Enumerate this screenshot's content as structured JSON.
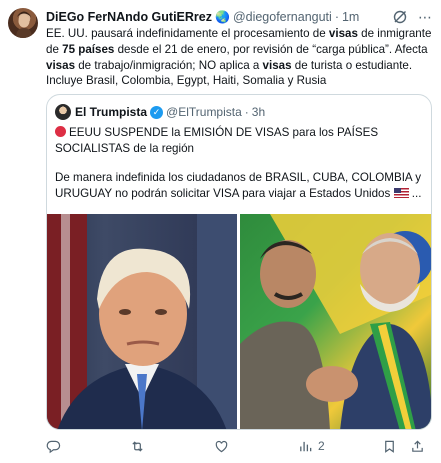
{
  "tweet": {
    "author_name": "DiEGo FerNAndo GutiERrez",
    "author_badge": "🌏",
    "handle": "@diegofernanguti",
    "separator": "·",
    "time": "1m",
    "text_parts": [
      {
        "t": "EE. UU. pausará indefinidamente el procesamiento de ",
        "b": false
      },
      {
        "t": "visas",
        "b": true
      },
      {
        "t": " de inmigrante de ",
        "b": false
      },
      {
        "t": "75 países",
        "b": true
      },
      {
        "t": " desde el 21 de enero, por revisión de “carga pública”. Afecta ",
        "b": false
      },
      {
        "t": "visas",
        "b": true
      },
      {
        "t": " de trabajo/inmigración; NO aplica a ",
        "b": false
      },
      {
        "t": "visas",
        "b": true
      },
      {
        "t": " de turista o estudiante. Incluye Brasil, Colombia, Egypt, Haiti, Somalia y Rusia",
        "b": false
      }
    ]
  },
  "quote": {
    "author_name": "El Trumpista",
    "verified_mark": "✓",
    "handle": "@ElTrumpista",
    "separator": "·",
    "time": "3h",
    "line1": "EEUU SUSPENDE la EMISIÓN DE VISAS para los PAÍSES SOCIALISTAS de la región",
    "line2": "De manera indefinida los ciudadanos de BRASIL, CUBA, COLOMBIA y URUGUAY no podrán solicitar VISA para viajar a Estados Unidos",
    "ellipsis": "..."
  },
  "actions": {
    "reply_count": "",
    "repost_count": "",
    "like_count": "",
    "views_count": "2"
  },
  "colors": {
    "accent": "#1d9bf0",
    "muted": "#536471",
    "border": "#cfd9de",
    "red_dot": "#dd2e44"
  },
  "icons": {
    "grok": "grok-slash-icon",
    "more": "more-dots-icon",
    "reply": "reply-bubble-icon",
    "repost": "repost-arrows-icon",
    "like": "heart-icon",
    "views": "bar-chart-icon",
    "bookmark": "bookmark-icon",
    "share": "share-icon"
  }
}
